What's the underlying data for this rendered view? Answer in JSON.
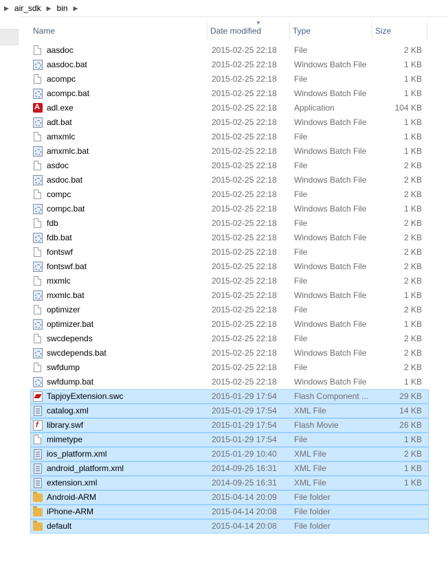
{
  "breadcrumb": [
    "air_sdk",
    "bin"
  ],
  "columns": {
    "name": "Name",
    "date": "Date modified",
    "type": "Type",
    "size": "Size"
  },
  "files": [
    {
      "name": "aasdoc",
      "date": "2015-02-25 22:18",
      "type": "File",
      "size": "2 KB",
      "icon": "file",
      "selected": false
    },
    {
      "name": "aasdoc.bat",
      "date": "2015-02-25 22:18",
      "type": "Windows Batch File",
      "size": "1 KB",
      "icon": "bat",
      "selected": false
    },
    {
      "name": "acompc",
      "date": "2015-02-25 22:18",
      "type": "File",
      "size": "1 KB",
      "icon": "file",
      "selected": false
    },
    {
      "name": "acompc.bat",
      "date": "2015-02-25 22:18",
      "type": "Windows Batch File",
      "size": "1 KB",
      "icon": "bat",
      "selected": false
    },
    {
      "name": "adl.exe",
      "date": "2015-02-25 22:18",
      "type": "Application",
      "size": "104 KB",
      "icon": "exe",
      "selected": false
    },
    {
      "name": "adt.bat",
      "date": "2015-02-25 22:18",
      "type": "Windows Batch File",
      "size": "1 KB",
      "icon": "bat",
      "selected": false
    },
    {
      "name": "amxmlc",
      "date": "2015-02-25 22:18",
      "type": "File",
      "size": "1 KB",
      "icon": "file",
      "selected": false
    },
    {
      "name": "amxmlc.bat",
      "date": "2015-02-25 22:18",
      "type": "Windows Batch File",
      "size": "1 KB",
      "icon": "bat",
      "selected": false
    },
    {
      "name": "asdoc",
      "date": "2015-02-25 22:18",
      "type": "File",
      "size": "2 KB",
      "icon": "file",
      "selected": false
    },
    {
      "name": "asdoc.bat",
      "date": "2015-02-25 22:18",
      "type": "Windows Batch File",
      "size": "2 KB",
      "icon": "bat",
      "selected": false
    },
    {
      "name": "compc",
      "date": "2015-02-25 22:18",
      "type": "File",
      "size": "2 KB",
      "icon": "file",
      "selected": false
    },
    {
      "name": "compc.bat",
      "date": "2015-02-25 22:18",
      "type": "Windows Batch File",
      "size": "1 KB",
      "icon": "bat",
      "selected": false
    },
    {
      "name": "fdb",
      "date": "2015-02-25 22:18",
      "type": "File",
      "size": "2 KB",
      "icon": "file",
      "selected": false
    },
    {
      "name": "fdb.bat",
      "date": "2015-02-25 22:18",
      "type": "Windows Batch File",
      "size": "2 KB",
      "icon": "bat",
      "selected": false
    },
    {
      "name": "fontswf",
      "date": "2015-02-25 22:18",
      "type": "File",
      "size": "2 KB",
      "icon": "file",
      "selected": false
    },
    {
      "name": "fontswf.bat",
      "date": "2015-02-25 22:18",
      "type": "Windows Batch File",
      "size": "2 KB",
      "icon": "bat",
      "selected": false
    },
    {
      "name": "mxmlc",
      "date": "2015-02-25 22:18",
      "type": "File",
      "size": "2 KB",
      "icon": "file",
      "selected": false
    },
    {
      "name": "mxmlc.bat",
      "date": "2015-02-25 22:18",
      "type": "Windows Batch File",
      "size": "1 KB",
      "icon": "bat",
      "selected": false
    },
    {
      "name": "optimizer",
      "date": "2015-02-25 22:18",
      "type": "File",
      "size": "2 KB",
      "icon": "file",
      "selected": false
    },
    {
      "name": "optimizer.bat",
      "date": "2015-02-25 22:18",
      "type": "Windows Batch File",
      "size": "1 KB",
      "icon": "bat",
      "selected": false
    },
    {
      "name": "swcdepends",
      "date": "2015-02-25 22:18",
      "type": "File",
      "size": "2 KB",
      "icon": "file",
      "selected": false
    },
    {
      "name": "swcdepends.bat",
      "date": "2015-02-25 22:18",
      "type": "Windows Batch File",
      "size": "2 KB",
      "icon": "bat",
      "selected": false
    },
    {
      "name": "swfdump",
      "date": "2015-02-25 22:18",
      "type": "File",
      "size": "2 KB",
      "icon": "file",
      "selected": false
    },
    {
      "name": "swfdump.bat",
      "date": "2015-02-25 22:18",
      "type": "Windows Batch File",
      "size": "1 KB",
      "icon": "bat",
      "selected": false
    },
    {
      "name": "TapjoyExtension.swc",
      "date": "2015-01-29 17:54",
      "type": "Flash Component ...",
      "size": "29 KB",
      "icon": "swc",
      "selected": true
    },
    {
      "name": "catalog.xml",
      "date": "2015-01-29 17:54",
      "type": "XML File",
      "size": "14 KB",
      "icon": "xml",
      "selected": true
    },
    {
      "name": "library.swf",
      "date": "2015-01-29 17:54",
      "type": "Flash Movie",
      "size": "26 KB",
      "icon": "swf",
      "selected": true
    },
    {
      "name": "mimetype",
      "date": "2015-01-29 17:54",
      "type": "File",
      "size": "1 KB",
      "icon": "file",
      "selected": true
    },
    {
      "name": "ios_platform.xml",
      "date": "2015-01-29 10:40",
      "type": "XML File",
      "size": "2 KB",
      "icon": "xml",
      "selected": true
    },
    {
      "name": "android_platform.xml",
      "date": "2014-09-25 16:31",
      "type": "XML File",
      "size": "1 KB",
      "icon": "xml",
      "selected": true
    },
    {
      "name": "extension.xml",
      "date": "2014-09-25 16:31",
      "type": "XML File",
      "size": "1 KB",
      "icon": "xml",
      "selected": true
    },
    {
      "name": "Android-ARM",
      "date": "2015-04-14 20:09",
      "type": "File folder",
      "size": "",
      "icon": "folder",
      "selected": true
    },
    {
      "name": "iPhone-ARM",
      "date": "2015-04-14 20:08",
      "type": "File folder",
      "size": "",
      "icon": "folder",
      "selected": true
    },
    {
      "name": "default",
      "date": "2015-04-14 20:08",
      "type": "File folder",
      "size": "",
      "icon": "folder",
      "selected": true
    }
  ],
  "colors": {
    "selection_bg": "#cce8ff",
    "selection_border": "#99d1ff",
    "header_text": "#4c607a"
  }
}
